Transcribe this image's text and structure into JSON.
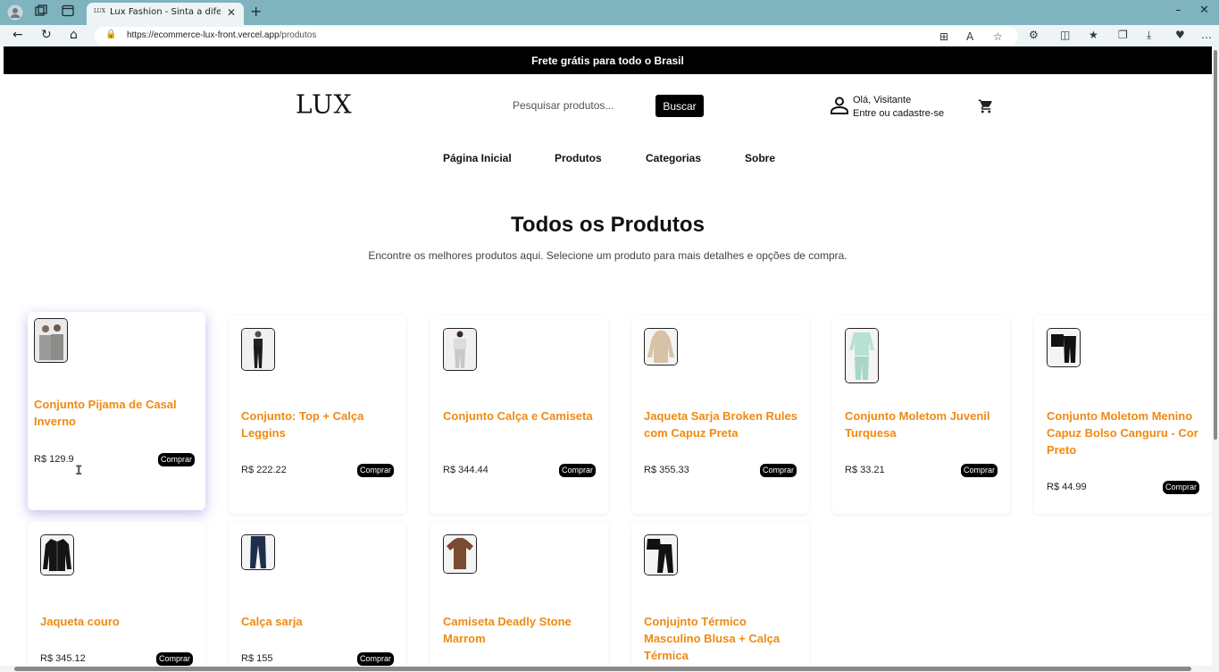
{
  "browser": {
    "tab_title": "Lux Fashion - Sinta a diferença de",
    "tab_favicon": "LUX",
    "url_host": "https://ecommerce-lux-front.vercel.app",
    "url_path": "/produtos"
  },
  "promo": "Frete grátis para todo o Brasil",
  "header": {
    "logo": "LUX",
    "search_placeholder": "Pesquisar produtos...",
    "search_button": "Buscar",
    "greeting": "Olá, Visitante",
    "login_link": "Entre ou cadastre-se"
  },
  "nav": [
    "Página Inicial",
    "Produtos",
    "Categorias",
    "Sobre"
  ],
  "page_title": "Todos os Produtos",
  "page_subtitle": "Encontre os melhores produtos aqui. Selecione um produto para mais detalhes e opções de compra.",
  "buy_label": "Comprar",
  "products": [
    {
      "name": "Conjunto Pijama de Casal Inverno",
      "price": "R$ 129.9",
      "image": "couple-pajama"
    },
    {
      "name": "Conjunto: Top + Calça Leggins",
      "price": "R$ 222.22",
      "image": "top-leggings"
    },
    {
      "name": "Conjunto Calça e Camiseta",
      "price": "R$ 344.44",
      "image": "pants-tshirt"
    },
    {
      "name": "Jaqueta Sarja Broken Rules com Capuz Preta",
      "price": "R$ 355.33",
      "image": "hooded-jacket"
    },
    {
      "name": "Conjunto Moletom Juvenil Turquesa",
      "price": "R$ 33.21",
      "image": "turquoise-sweatsuit"
    },
    {
      "name": "Conjunto Moletom Menino Capuz Bolso Canguru - Cor Preto",
      "price": "R$ 44.99",
      "image": "black-sweatsuit"
    },
    {
      "name": "Jaqueta couro",
      "price": "R$ 345.12",
      "image": "leather-jacket"
    },
    {
      "name": "Calça sarja",
      "price": "R$ 155",
      "image": "twill-pants"
    },
    {
      "name": "Camiseta Deadly Stone Marrom",
      "price": "",
      "image": "brown-tshirt"
    },
    {
      "name": "Conjujnto Térmico Masculino Blusa + Calça Térmica",
      "price": "",
      "image": "thermal-set"
    }
  ]
}
